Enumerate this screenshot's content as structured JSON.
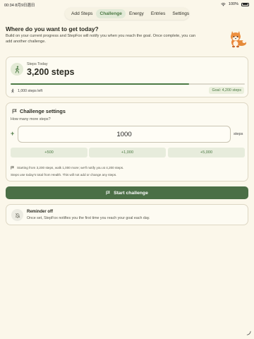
{
  "status_bar": {
    "time": "00:34",
    "date": "8月9日週日",
    "battery": "100%"
  },
  "tabs": [
    "Add Steps",
    "Challenge",
    "Energy",
    "Entries",
    "Settings"
  ],
  "active_tab": "Challenge",
  "heading": "Where do you want to get today?",
  "subtext": "Build on your current progress and StepFox will notify you when you reach the goal. Once complete, you can add another challenge.",
  "steps_card": {
    "label": "Steps Today",
    "value": "3,200 steps",
    "progress": 0.7619,
    "steps_left": "1,000 steps left",
    "goal": "Goal: 4,200 steps"
  },
  "challenge_settings": {
    "title": "Challenge settings",
    "question": "How many more steps?",
    "input_value": "1000",
    "unit": "steps",
    "quick_add": [
      "+500",
      "+1,000",
      "+5,000"
    ],
    "info": "Starting from 3,200 steps, walk 1,000 more; we'll notify you at 4,200 steps.",
    "note": "Steps use today's total from Health. This will not add or change any steps."
  },
  "start_button": "Start challenge",
  "reminder": {
    "title": "Reminder off",
    "text": "Once set, StepFox notifies you the first time you reach your goal each day."
  },
  "colors": {
    "accent": "#4d7a45",
    "background": "#fbf7ea",
    "button": "#4b6f46"
  }
}
